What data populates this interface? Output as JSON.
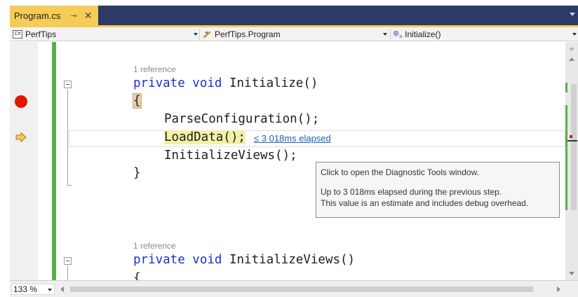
{
  "tab": {
    "title": "Program.cs",
    "pin_icon": "pin-icon",
    "close_icon": "close-icon"
  },
  "navbar": {
    "project": "PerfTips",
    "project_icon": "csharp-project-icon",
    "type": "PerfTips.Program",
    "type_icon": "class-icon",
    "member": "Initialize()",
    "member_icon": "method-icon"
  },
  "code": {
    "lens1": "1 reference",
    "sig1_kw": "private void",
    "sig1_name": " Initialize()",
    "open_brace": "{",
    "call1": "ParseConfiguration();",
    "call2_stmt": "LoadData();",
    "call3": "InitializeViews();",
    "close_brace": "}",
    "lens2": "1 reference",
    "sig2_kw": "private void",
    "sig2_name": " InitializeViews()",
    "partial_brace": "{"
  },
  "perftip": {
    "label": "≤ 3 018ms elapsed"
  },
  "tooltip": {
    "line1": "Click to open the Diagnostic Tools window.",
    "line2": "Up to 3 018ms elapsed during the previous step.",
    "line3": "This value is an estimate and includes debug overhead."
  },
  "statusbar": {
    "zoom": "133 %"
  },
  "colors": {
    "tab_active": "#f5cc57",
    "tab_strip": "#2b3a66",
    "keyword": "#1a2fd6",
    "breakpoint": "#e51400",
    "instruction_pointer": "#f5cc57",
    "changed_lines": "#57b14a",
    "link": "#1f5fb5"
  }
}
